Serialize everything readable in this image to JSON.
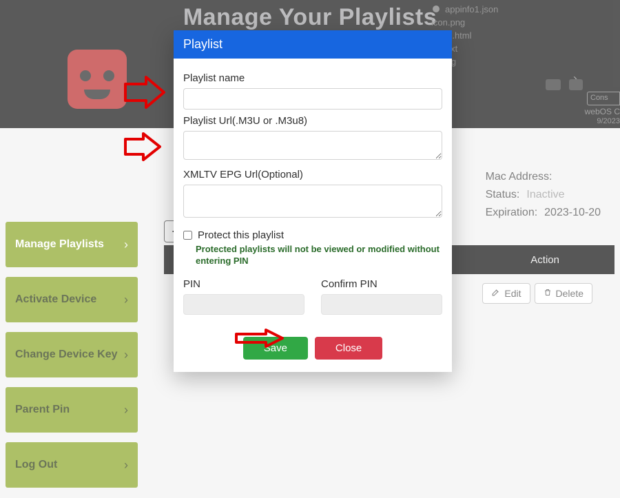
{
  "hero": {
    "title": "Manage Your Playlists"
  },
  "background_files": [
    "appinfo1.json",
    "icon.png",
    "miles.html",
    "info.txt",
    "m.png"
  ],
  "side_badges": {
    "cons": "Cons",
    "webos": "webOS C",
    "date": "9/2023"
  },
  "sidebar": {
    "items": [
      {
        "label": "Manage Playlists",
        "active": true
      },
      {
        "label": "Activate Device",
        "active": false
      },
      {
        "label": "Change Device Key",
        "active": false
      },
      {
        "label": "Parent Pin",
        "active": false
      },
      {
        "label": "Log Out",
        "active": false
      }
    ]
  },
  "info": {
    "mac_label": "Mac Address:",
    "status_label": "Status:",
    "status_value": "Inactive",
    "exp_label": "Expiration:",
    "exp_value": "2023-10-20"
  },
  "table": {
    "action_header": "Action",
    "edit": "Edit",
    "delete": "Delete"
  },
  "modal": {
    "title": "Playlist",
    "name_label": "Playlist name",
    "url_label": "Playlist Url(.M3U or .M3u8)",
    "epg_label": "XMLTV EPG Url(Optional)",
    "protect_label": "Protect this playlist",
    "protect_hint": "Protected playlists will not be viewed or modified without entering PIN",
    "pin_label": "PIN",
    "confirm_pin_label": "Confirm PIN",
    "save": "Save",
    "close": "Close"
  }
}
